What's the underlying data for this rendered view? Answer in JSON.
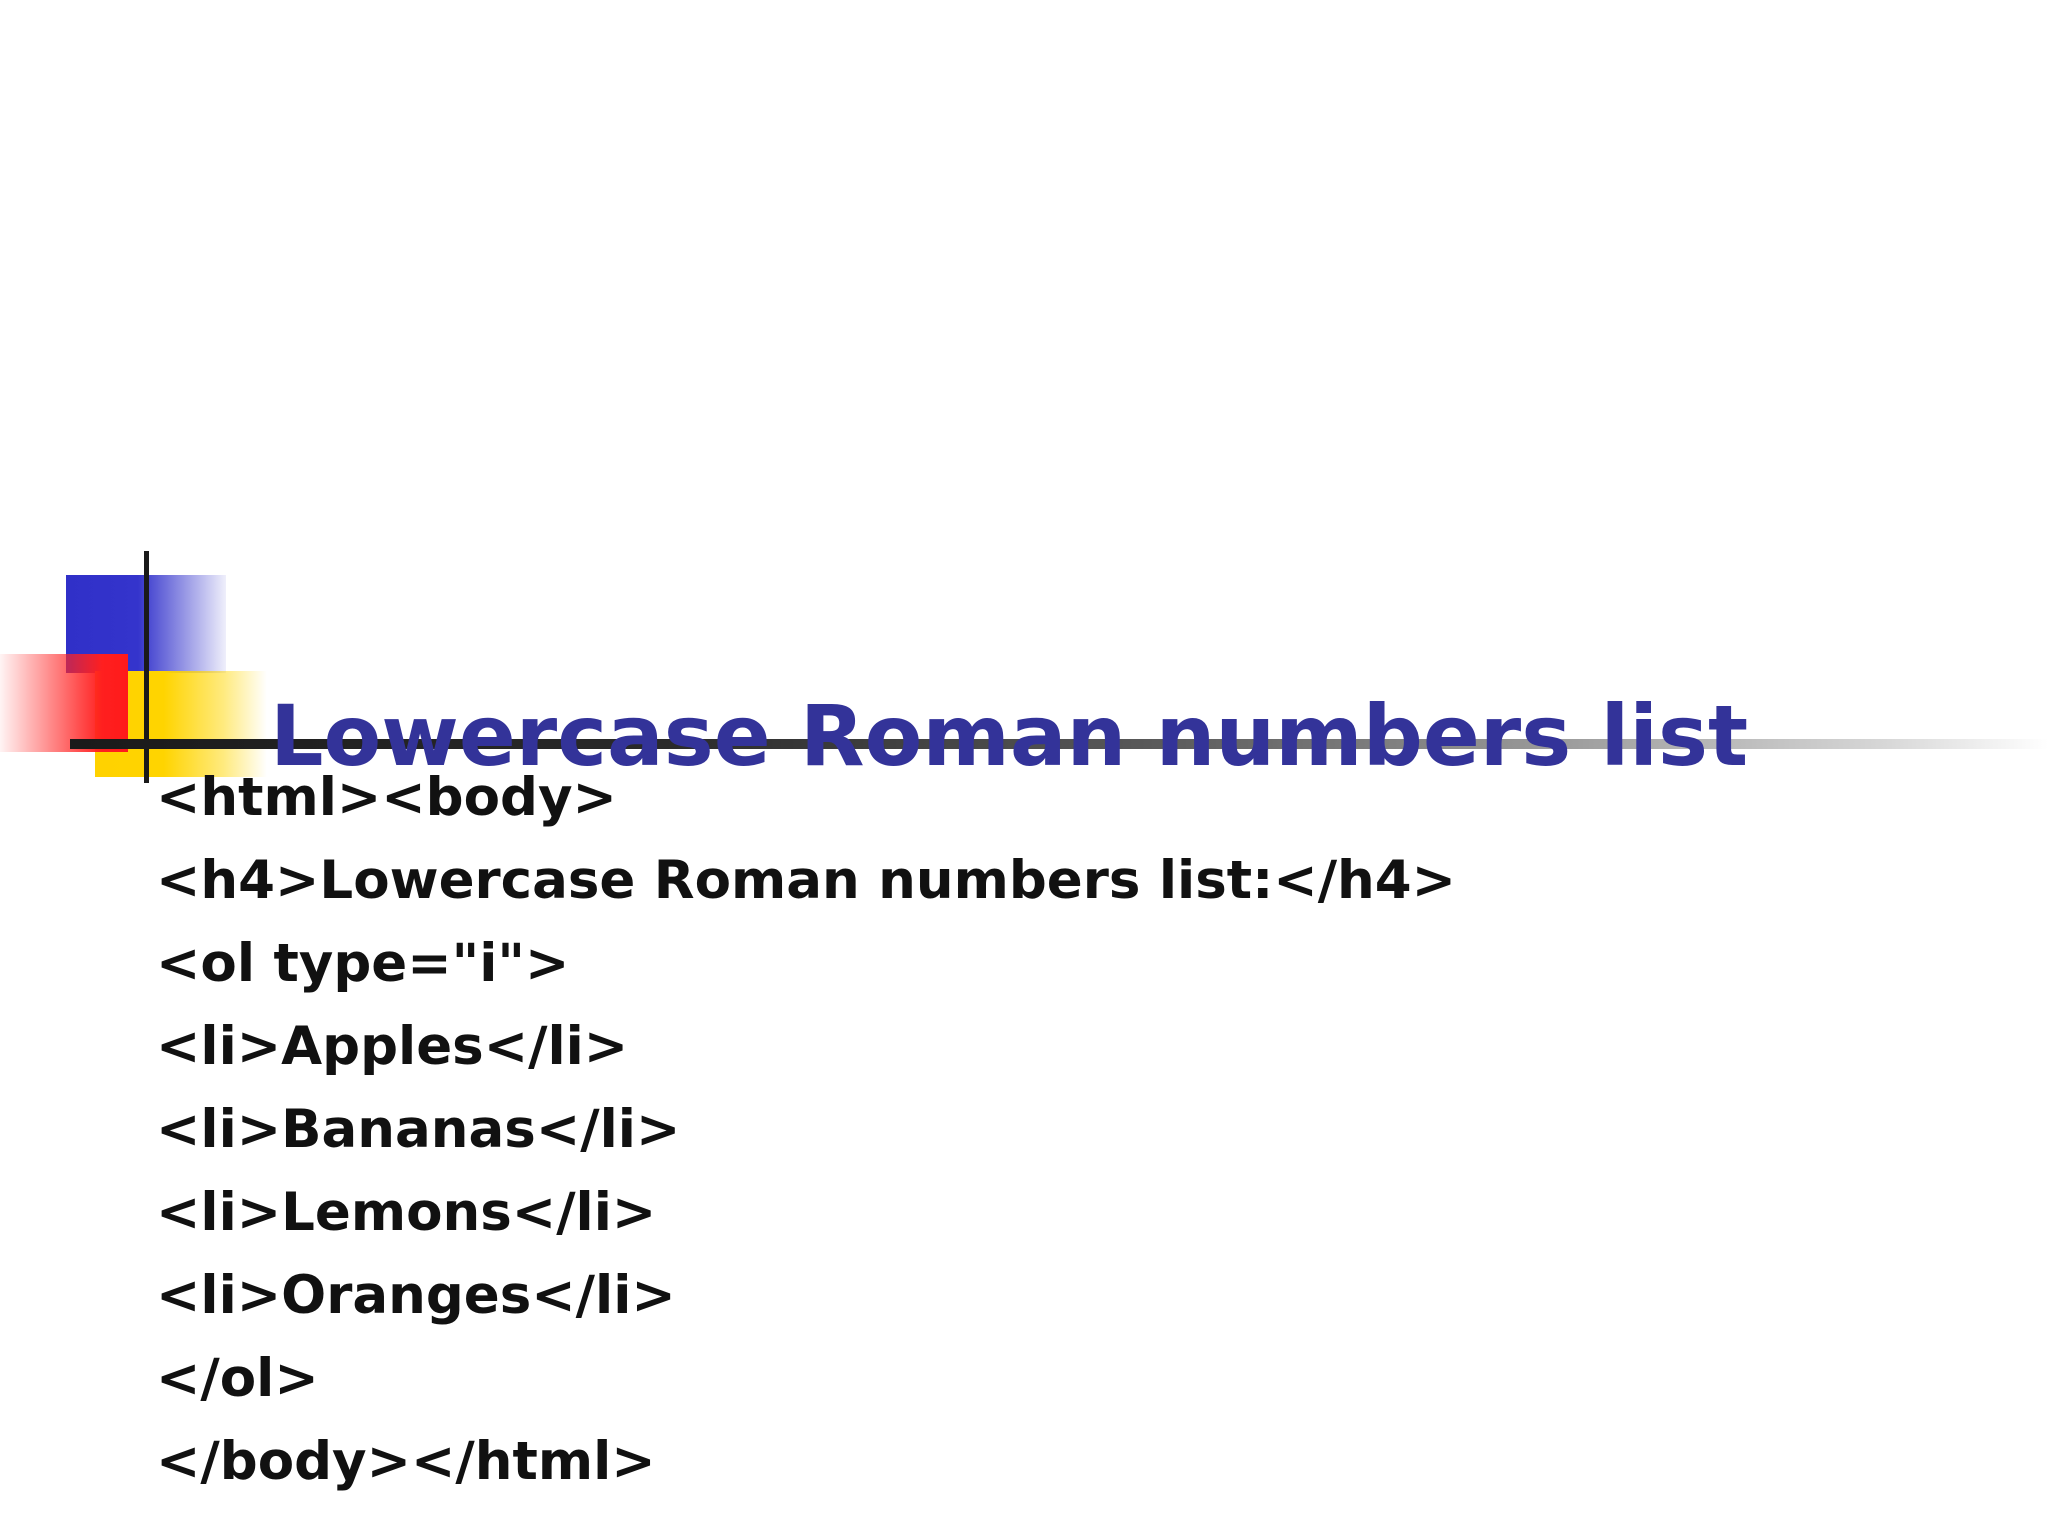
{
  "slide": {
    "title": "Lowercase Roman numbers list",
    "title_color": "#333399",
    "code_lines": [
      "<html><body>",
      "<h4>Lowercase Roman numbers list:</h4>",
      "<ol type=\"i\">",
      "<li>Apples</li>",
      "<li>Bananas</li>",
      "<li>Lemons</li>",
      "<li>Oranges</li>",
      "</ol>",
      "</body></html>"
    ]
  },
  "decoration": {
    "colors": {
      "blue": "#3434cc",
      "yellow": "#ffd400",
      "red": "#ff1f1f",
      "line": "#1a1a1a"
    }
  }
}
